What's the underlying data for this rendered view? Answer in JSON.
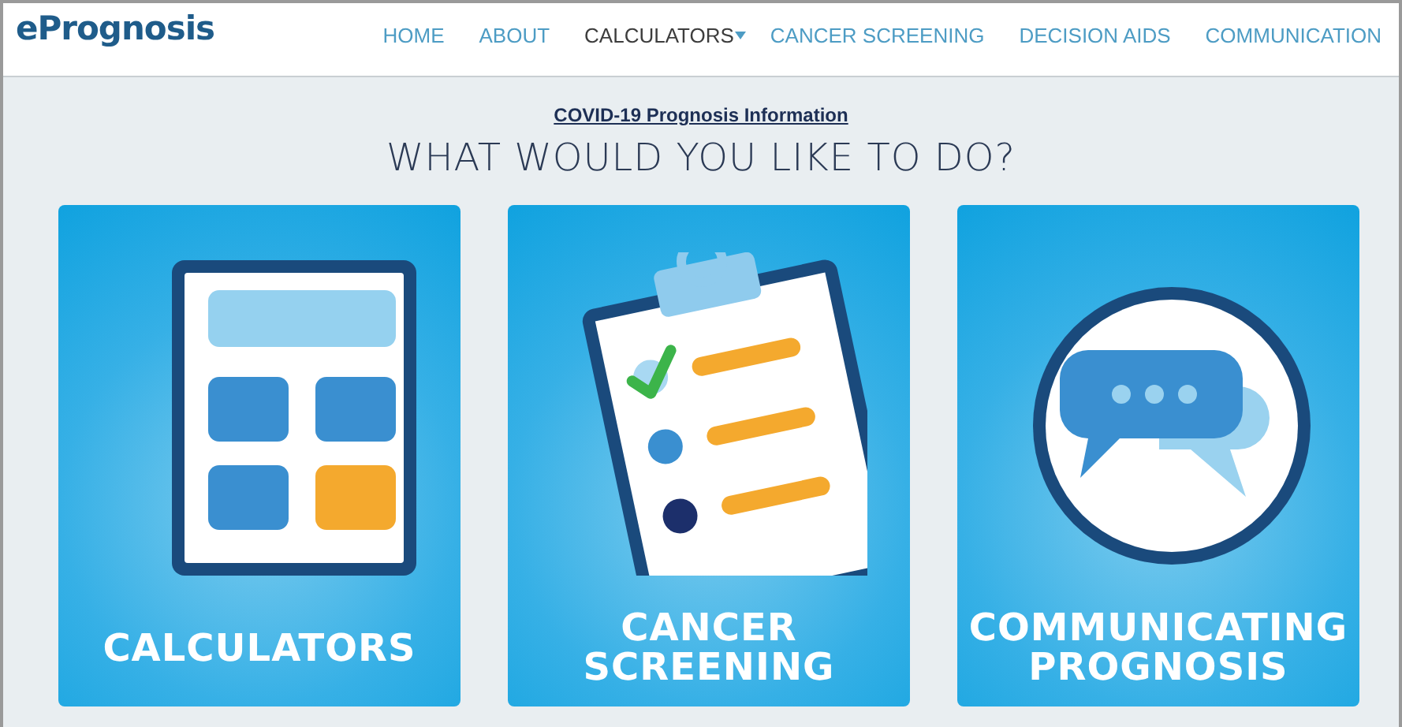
{
  "header": {
    "logo": "ePrognosis",
    "nav": [
      {
        "label": "HOME",
        "selected": false,
        "kind": "link"
      },
      {
        "label": "ABOUT",
        "selected": false,
        "kind": "link"
      },
      {
        "label": "CALCULATORS",
        "selected": true,
        "kind": "dropdown"
      },
      {
        "label": "CANCER SCREENING",
        "selected": false,
        "kind": "link"
      },
      {
        "label": "DECISION AIDS",
        "selected": false,
        "kind": "link"
      },
      {
        "label": "COMMUNICATION",
        "selected": false,
        "kind": "link"
      }
    ]
  },
  "notice_link": "COVID-19 Prognosis Information",
  "heading": "WHAT WOULD YOU LIKE TO DO?",
  "cards": [
    {
      "kind": "calculator",
      "lines": [
        "CALCULATORS"
      ]
    },
    {
      "kind": "clipboard",
      "lines": [
        "CANCER",
        "SCREENING"
      ]
    },
    {
      "kind": "chat",
      "lines": [
        "COMMUNICATING",
        "PROGNOSIS"
      ]
    }
  ]
}
